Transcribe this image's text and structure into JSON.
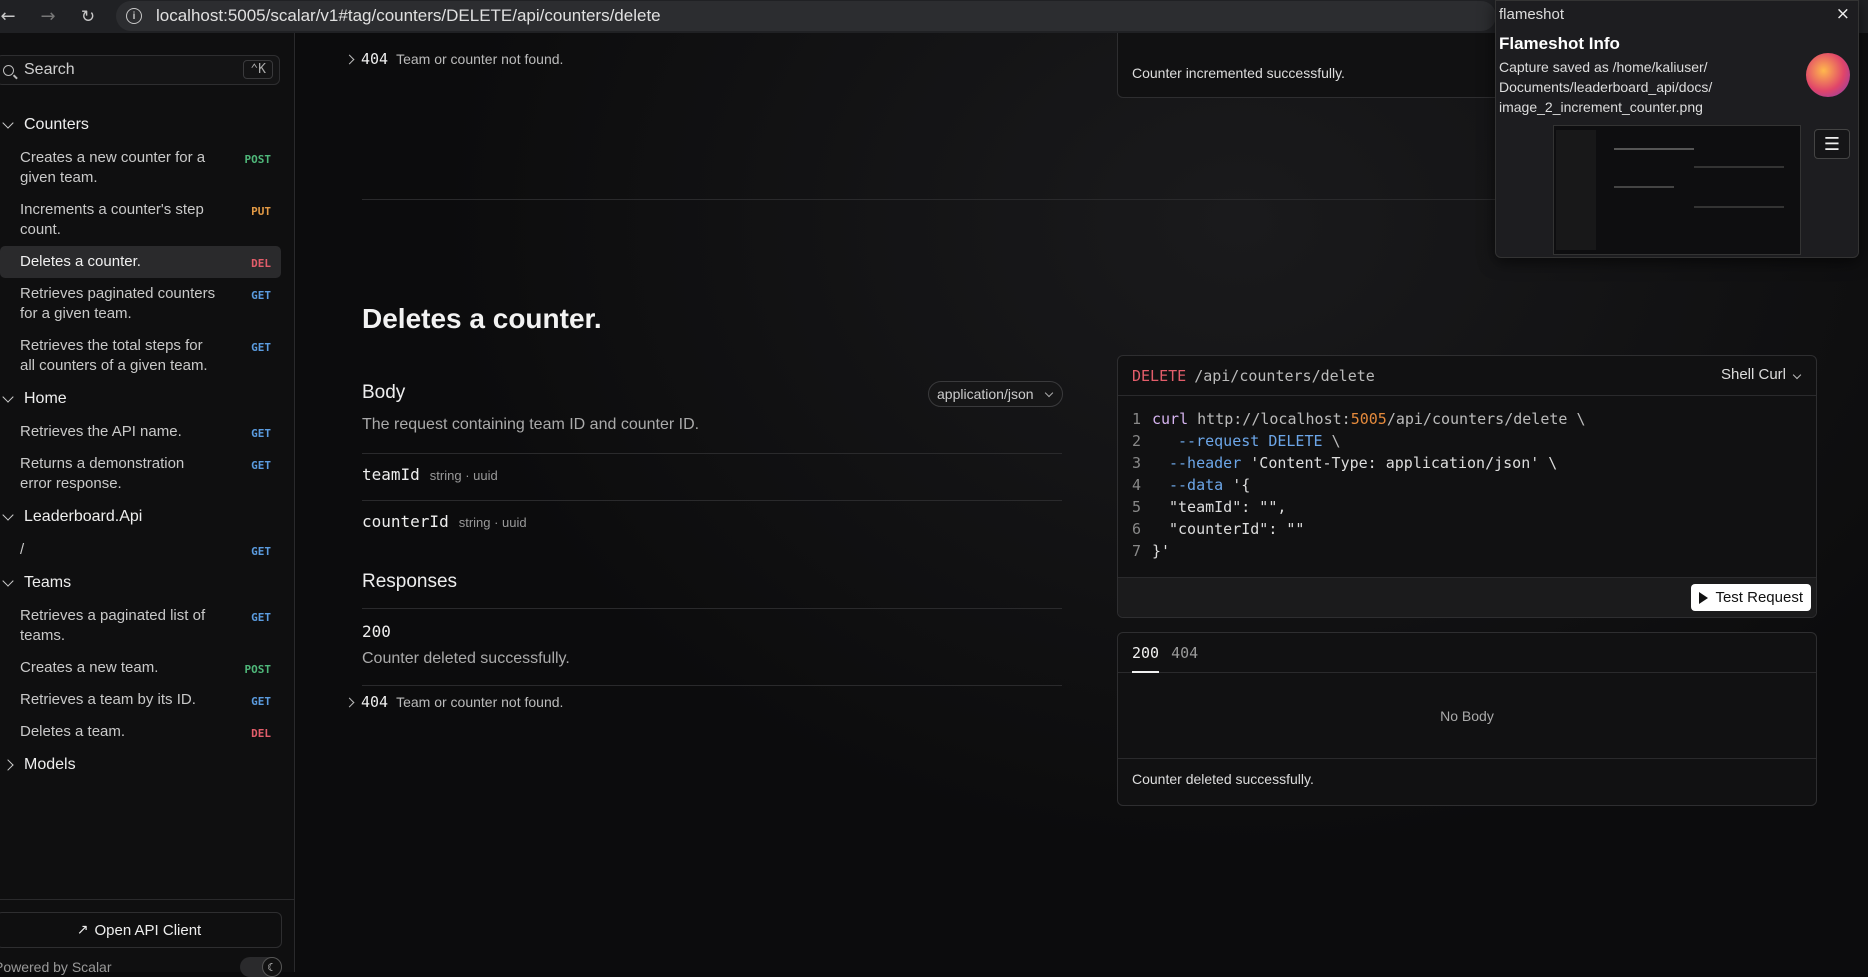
{
  "browser": {
    "back_glyph": "←",
    "forward_glyph": "→",
    "reload_glyph": "↻",
    "info_glyph": "i",
    "url": "localhost:5005/scalar/v1#tag/counters/DELETE/api/counters/delete"
  },
  "sidebar": {
    "search_label": "Search",
    "search_shortcut": "⌃K",
    "groups": [
      {
        "label": "Counters",
        "expanded": true,
        "items": [
          {
            "label": "Creates a new counter for a given team.",
            "method": "POST"
          },
          {
            "label": "Increments a counter's step count.",
            "method": "PUT"
          },
          {
            "label": "Deletes a counter.",
            "method": "DEL",
            "active": true
          },
          {
            "label": "Retrieves paginated counters for a given team.",
            "method": "GET"
          },
          {
            "label": "Retrieves the total steps for all counters of a given team.",
            "method": "GET"
          }
        ]
      },
      {
        "label": "Home",
        "expanded": true,
        "items": [
          {
            "label": "Retrieves the API name.",
            "method": "GET"
          },
          {
            "label": "Returns a demonstration error response.",
            "method": "GET"
          }
        ]
      },
      {
        "label": "Leaderboard.Api",
        "expanded": true,
        "items": [
          {
            "label": "/",
            "method": "GET"
          }
        ]
      },
      {
        "label": "Teams",
        "expanded": true,
        "items": [
          {
            "label": "Retrieves a paginated list of teams.",
            "method": "GET"
          },
          {
            "label": "Creates a new team.",
            "method": "POST"
          },
          {
            "label": "Retrieves a team by its ID.",
            "method": "GET"
          },
          {
            "label": "Deletes a team.",
            "method": "DEL"
          }
        ]
      },
      {
        "label": "Models",
        "expanded": false,
        "items": []
      }
    ],
    "open_client_label": "Open API Client",
    "arrow_glyph": "↗",
    "powered_by": "Powered by Scalar",
    "theme_glyph": "☾"
  },
  "main": {
    "prev_404_code": "404",
    "prev_404_desc": "Team or counter not found.",
    "prev_response_text": "Counter incremented successfully.",
    "title": "Deletes a counter.",
    "body_title": "Body",
    "content_type": "application/json",
    "body_description": "The request containing team ID and counter ID.",
    "fields": [
      {
        "name": "teamId",
        "type": "string · uuid"
      },
      {
        "name": "counterId",
        "type": "string · uuid"
      }
    ],
    "responses_title": "Responses",
    "response_200_code": "200",
    "response_200_desc": "Counter deleted successfully.",
    "response_404_code": "404",
    "response_404_desc": "Team or counter not found."
  },
  "code_sample": {
    "method": "DELETE",
    "path": "/api/counters/delete",
    "language": "Shell Curl",
    "lines": {
      "n1": "1",
      "n2": "2",
      "n3": "3",
      "n4": "4",
      "n5": "5",
      "n6": "6",
      "n7": "7",
      "l1_cmd": "curl",
      "l1_url_a": "http://localhost:",
      "l1_port": "5005",
      "l1_url_b": "/api/counters/delete \\",
      "l2_flag": "--request",
      "l2_val": "DELETE",
      "l2_tail": " \\",
      "l3_flag": "--header",
      "l3_val": "'Content-Type: application/json' \\",
      "l4_flag": "--data",
      "l4_val": "'{",
      "l5": "\"teamId\": \"\",",
      "l6": "\"counterId\": \"\"",
      "l7": "}'"
    },
    "test_button": "Test Request"
  },
  "response_panel": {
    "tabs": [
      "200",
      "404"
    ],
    "no_body": "No Body",
    "footer": "Counter deleted successfully."
  },
  "notification": {
    "app": "flameshot",
    "close_glyph": "×",
    "title": "Flameshot Info",
    "body": "Capture saved as /home/kaliuser/ Documents/leaderboard_api/docs/ image_2_increment_counter.png",
    "menu_glyph": "☰"
  },
  "colors": {
    "post": "#4fb87a",
    "put": "#e39a45",
    "del": "#e35d6a",
    "get": "#5b9ce0"
  }
}
